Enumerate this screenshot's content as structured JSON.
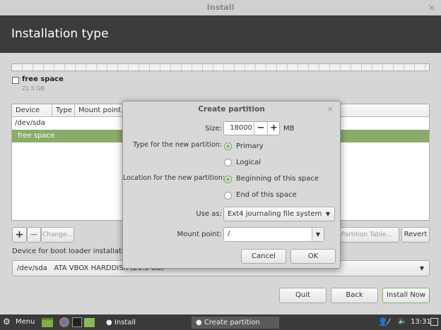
{
  "window": {
    "title": "Install",
    "close": "×"
  },
  "header": {
    "title": "Installation type"
  },
  "disk": {
    "label": "free space",
    "size": "21.5 GB"
  },
  "table": {
    "columns": [
      "Device",
      "Type",
      "Mount point"
    ],
    "rows": [
      "/dev/sda",
      "free space"
    ]
  },
  "toolbar": {
    "add": "+",
    "remove": "−",
    "change": "Change...",
    "new_table": "New Partition Table...",
    "revert": "Revert"
  },
  "bootloader": {
    "label": "Device for boot loader installation:",
    "value": "/dev/sda   ATA VBOX HARDDISK (21.5 GB)"
  },
  "buttons": {
    "quit": "Quit",
    "back": "Back",
    "install": "Install Now"
  },
  "dialog": {
    "title": "Create partition",
    "close": "×",
    "size_label": "Size:",
    "size_value": "18000",
    "minus": "−",
    "plus": "+",
    "unit": "MB",
    "type_label": "Type for the new partition:",
    "primary": "Primary",
    "logical": "Logical",
    "location_label": "Location for the new partition:",
    "beginning": "Beginning of this space",
    "end": "End of this space",
    "use_as_label": "Use as:",
    "use_as_value": "Ext4 journaling file system",
    "mount_label": "Mount point:",
    "mount_value": "/",
    "cancel": "Cancel",
    "ok": "OK"
  },
  "taskbar": {
    "menu": "Menu",
    "task1": "Install",
    "task2": "Create partition",
    "clock": "13:31"
  },
  "colors": {
    "accent": "#8aab6a",
    "header": "#3c3c3c"
  }
}
